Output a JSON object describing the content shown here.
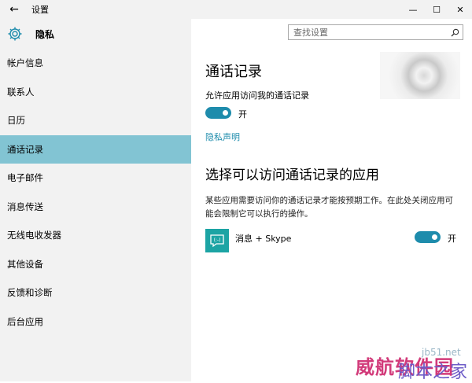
{
  "window": {
    "title": "设置",
    "back_glyph": "←",
    "minimize_glyph": "—",
    "maximize_glyph": "☐",
    "close_glyph": "✕"
  },
  "sidebar": {
    "section_title": "隐私",
    "items": [
      {
        "label": "帐户信息"
      },
      {
        "label": "联系人"
      },
      {
        "label": "日历"
      },
      {
        "label": "通话记录"
      },
      {
        "label": "电子邮件"
      },
      {
        "label": "消息传送"
      },
      {
        "label": "无线电收发器"
      },
      {
        "label": "其他设备"
      },
      {
        "label": "反馈和诊断"
      },
      {
        "label": "后台应用"
      }
    ],
    "active_index": 3
  },
  "search": {
    "placeholder": "查找设置"
  },
  "main": {
    "title": "通话记录",
    "allow_label": "允许应用访问我的通话记录",
    "allow_toggle_label": "开",
    "privacy_link": "隐私声明",
    "apps_title": "选择可以访问通话记录的应用",
    "apps_description": "某些应用需要访问你的通话记录才能按预期工作。在此处关闭应用可能会限制它可以执行的操作。",
    "apps": [
      {
        "name": "消息 + Skype",
        "toggle_label": "开"
      }
    ]
  },
  "watermark": {
    "text_a": "jb51.net",
    "text_b": "威航软件园",
    "text_c": "脚本之家"
  },
  "colors": {
    "accent": "#1e8cac",
    "selected_nav": "#82c4d3",
    "app_tile": "#1ca4a4",
    "pane_bg": "#f2f2f2"
  }
}
